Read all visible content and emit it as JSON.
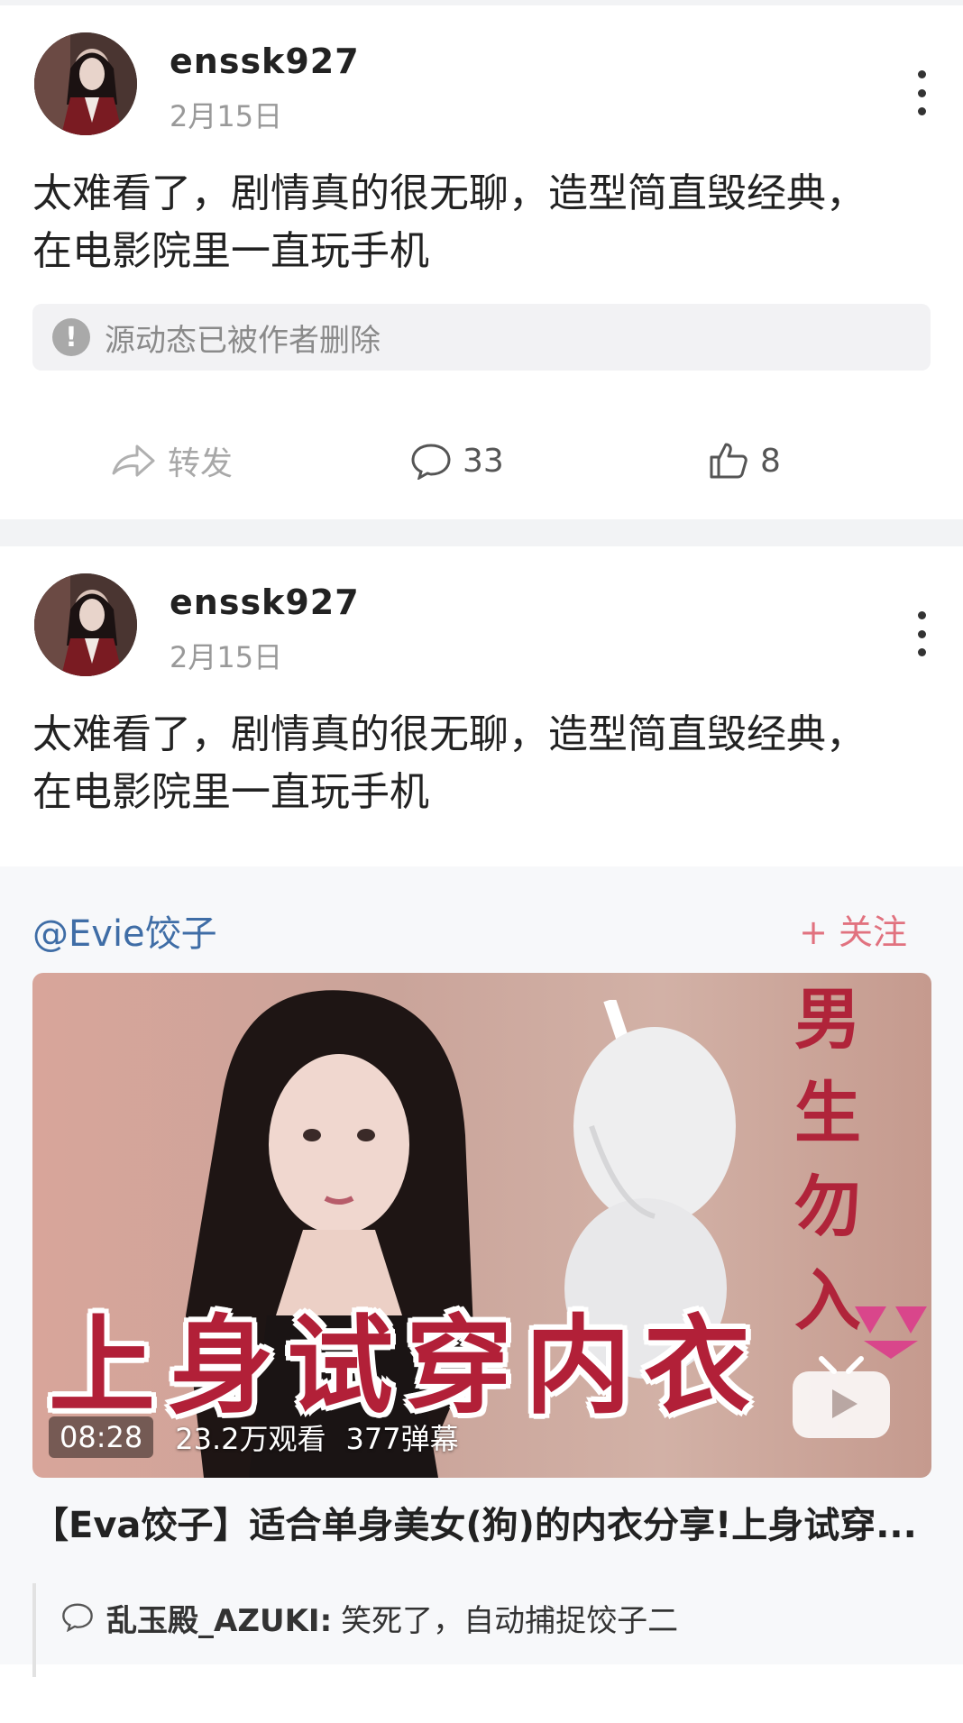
{
  "posts": [
    {
      "username": "enssk927",
      "date": "2月15日",
      "content_line1": "太难看了，剧情真的很无聊，造型简直毁经典，",
      "content_line2": "在电影院里一直玩手机",
      "deleted_notice": "源动态已被作者删除",
      "repost_label": "转发",
      "comment_count": "33",
      "like_count": "8"
    },
    {
      "username": "enssk927",
      "date": "2月15日",
      "content_line1": "太难看了，剧情真的很无聊，造型简直毁经典，",
      "content_line2": "在电影院里一直玩手机",
      "repost": {
        "handle": "@Evie饺子",
        "follow_label": "+ 关注",
        "video": {
          "overlay_title": "上身试穿内衣",
          "side_text": [
            "男",
            "生",
            "勿",
            "入"
          ],
          "duration": "08:28",
          "views": "23.2万观看",
          "danmaku": "377弹幕"
        },
        "caption": "【Eva饺子】适合单身美女(狗)的内衣分享!上身试穿...",
        "comment_author": "乱玉殿_AZUKI:",
        "comment_text": "笑死了，自动捕捉饺子二"
      }
    }
  ],
  "colors": {
    "link": "#3f6da6",
    "follow": "#e1727f",
    "video_title": "#b22038"
  }
}
